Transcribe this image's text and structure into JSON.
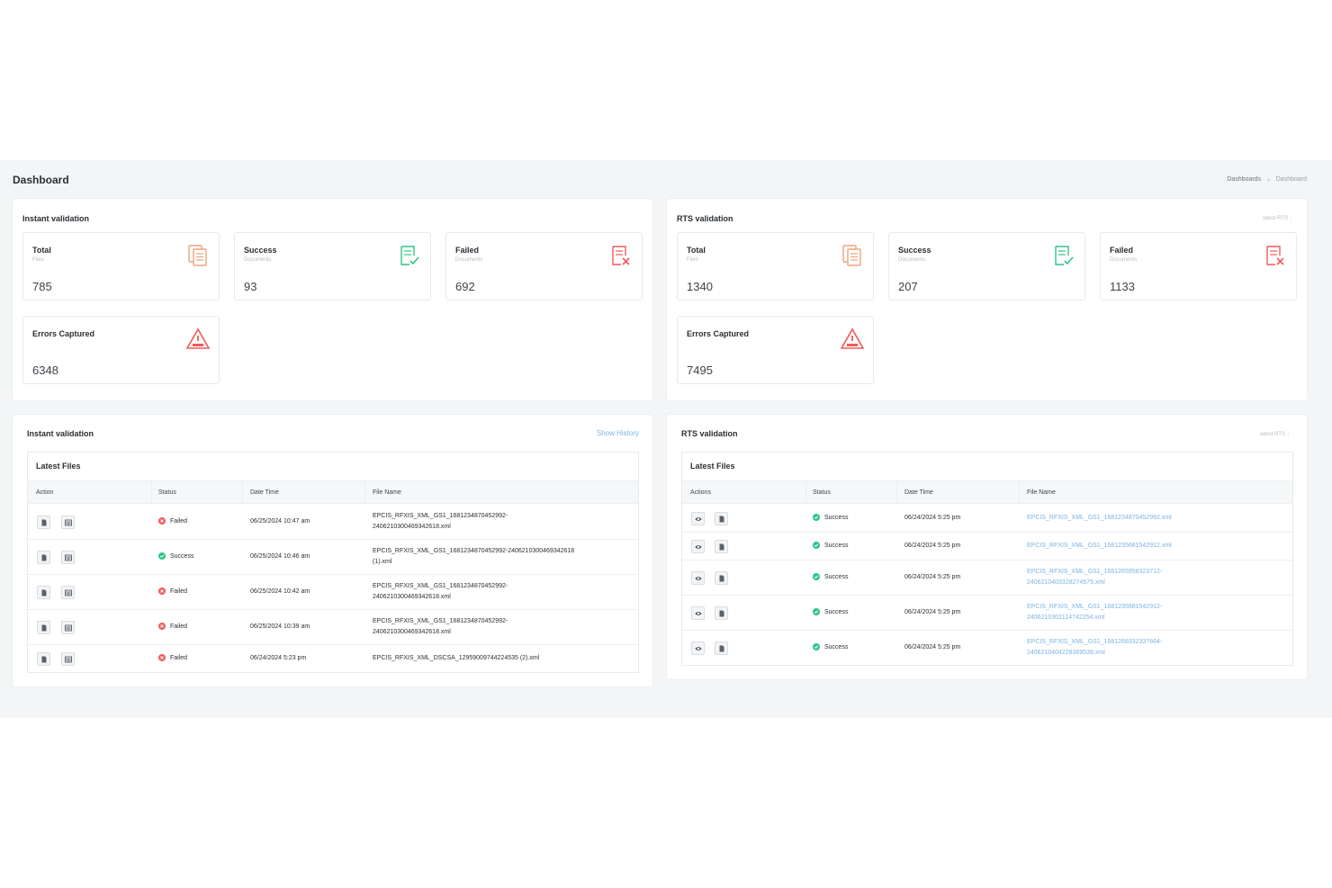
{
  "page": {
    "title": "Dashboard",
    "breadcrumb": [
      "Dashboards",
      "Dashboard"
    ]
  },
  "colors": {
    "background_band": "#f4f5f7",
    "success": "#2ec487",
    "failed": "#ef5a5a",
    "link": "#7ab3e6",
    "total_icon": "#f0a27a"
  },
  "instant_summary": {
    "title": "Instant validation",
    "total": {
      "label": "Total",
      "sub": "Files",
      "value": "785",
      "icon": "files-icon"
    },
    "success": {
      "label": "Success",
      "sub": "Documents",
      "value": "93",
      "icon": "document-check-icon"
    },
    "failed": {
      "label": "Failed",
      "sub": "Documents",
      "value": "692",
      "icon": "document-x-icon"
    },
    "errors": {
      "label": "Errors Captured",
      "value": "6348",
      "icon": "warning-icon"
    }
  },
  "rts_summary": {
    "title": "RTS validation",
    "link": "latest RTS",
    "total": {
      "label": "Total",
      "sub": "Files",
      "value": "1340",
      "icon": "files-icon"
    },
    "success": {
      "label": "Success",
      "sub": "Documents",
      "value": "207",
      "icon": "document-check-icon"
    },
    "failed": {
      "label": "Failed",
      "sub": "Documents",
      "value": "1133",
      "icon": "document-x-icon"
    },
    "errors": {
      "label": "Errors Captured",
      "value": "7495",
      "icon": "warning-icon"
    }
  },
  "instant_files": {
    "title": "Instant validation",
    "link": "Show History",
    "table_title": "Latest Files",
    "columns": [
      "Action",
      "Status",
      "Date Time",
      "File Name"
    ],
    "rows": [
      {
        "status": "Failed",
        "datetime": "06/25/2024 10:47 am",
        "file1": "EPCIS_RFXIS_XML_GS1_1681234870452992-",
        "file2": "2406210300469342618.xml"
      },
      {
        "status": "Success",
        "datetime": "06/25/2024 10:46 am",
        "file1": "EPCIS_RFXIS_XML_GS1_1681234870452992-2406210300469342618",
        "file2": "(1).xml"
      },
      {
        "status": "Failed",
        "datetime": "06/25/2024 10:42 am",
        "file1": "EPCIS_RFXIS_XML_GS1_1681234870452992-",
        "file2": "2406210300469342618.xml"
      },
      {
        "status": "Failed",
        "datetime": "06/25/2024 10:39 am",
        "file1": "EPCIS_RFXIS_XML_GS1_1681234870452992-",
        "file2": "2406210300469342618.xml"
      },
      {
        "status": "Failed",
        "datetime": "06/24/2024 5:23 pm",
        "file1": "EPCIS_RFXIS_XML_DSCSA_12959009744224535 (2).xml",
        "file2": ""
      }
    ]
  },
  "rts_files": {
    "title": "RTS validation",
    "link": "latest RTS",
    "table_title": "Latest Files",
    "columns": [
      "Actions",
      "Status",
      "Date Time",
      "File Name"
    ],
    "rows": [
      {
        "status": "Success",
        "datetime": "06/24/2024 5:25 pm",
        "file1": "EPCIS_RFXIS_XML_GS1_1681234870452992.xml",
        "file2": ""
      },
      {
        "status": "Success",
        "datetime": "06/24/2024 5:25 pm",
        "file1": "EPCIS_RFXIS_XML_GS1_1681235681542912.xml",
        "file2": ""
      },
      {
        "status": "Success",
        "datetime": "06/24/2024 5:25 pm",
        "file1": "EPCIS_RFXIS_XML_GS1_1681265958323712-",
        "file2": "2406210403328274975.xml"
      },
      {
        "status": "Success",
        "datetime": "06/24/2024 5:25 pm",
        "file1": "EPCIS_RFXIS_XML_GS1_1681235681542912-",
        "file2": "2406210302114742254.xml"
      },
      {
        "status": "Success",
        "datetime": "06/24/2024 5:25 pm",
        "file1": "EPCIS_RFXIS_XML_GS1_1681266332337664-",
        "file2": "2406210404228369538.xml"
      }
    ]
  }
}
